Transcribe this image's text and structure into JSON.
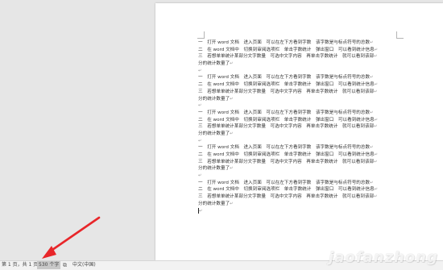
{
  "document": {
    "paragraphs": [
      {
        "lines": [
          "一　打开 word 文档　进入页面　可以在左下方看到字数　该字数是与标点符号的总数",
          "二　在 word 文档中　切换到审阅选项栏　单击字数统计　弹出窗口　可以看到统计信息",
          "三　若想单单统计某部分文字数量　可选中文字内容　再单击字数统计　就可以看到该部",
          "分的统计数量了"
        ]
      },
      {
        "lines": [
          "一　打开 word 文档　进入页面　可以在左下方看到字数　该字数是与标点符号的总数",
          "二　在 word 文档中　切换到审阅选项栏　单击字数统计　弹出窗口　可以看到统计信息",
          "三　若想单单统计某部分文字数量　可选中文字内容　再单击字数统计　就可以看到该部",
          "分的统计数量了"
        ]
      },
      {
        "lines": [
          "一　打开 word 文档　进入页面　可以在左下方看到字数　该字数是与标点符号的总数",
          "二　在 word 文档中　切换到审阅选项栏　单击字数统计　弹出窗口　可以看到统计信息",
          "三　若想单单统计某部分文字数量　可选中文字内容　再单击字数统计　就可以看到该部",
          "分的统计数量了"
        ]
      },
      {
        "lines": [
          "一　打开 word 文档　进入页面　可以在左下方看到字数　该字数是与标点符号的总数",
          "二　在 word 文档中　切换到审阅选项栏　单击字数统计　弹出窗口　可以看到统计信息",
          "三　若想单单统计某部分文字数量　可选中文字内容　再单击字数统计　就可以看到该部",
          "分的统计数量了"
        ]
      },
      {
        "lines": [
          "一　打开 word 文档　进入页面　可以在左下方看到字数　该字数是与标点符号的总数",
          "二　在 word 文档中　切换到审阅选项栏　单击字数统计　弹出窗口　可以看到统计信息",
          "三　若想单单统计某部分文字数量　可选中文字内容　再单击字数统计　就可以看到该部",
          "分的统计数量了"
        ]
      }
    ],
    "paragraph_mark": "↵"
  },
  "statusbar": {
    "page": "第 1 页，共 1 页",
    "words": "530 个字",
    "proofing_icon": "proofing-icon",
    "language": "中文(中国)"
  },
  "watermark": {
    "text": "jaofanzhong"
  },
  "colors": {
    "arrow": "#e8262a",
    "workspace": "#e6e6e6",
    "statusbar": "#f2f2f2",
    "word_count_highlight": "#c8c8c8"
  }
}
